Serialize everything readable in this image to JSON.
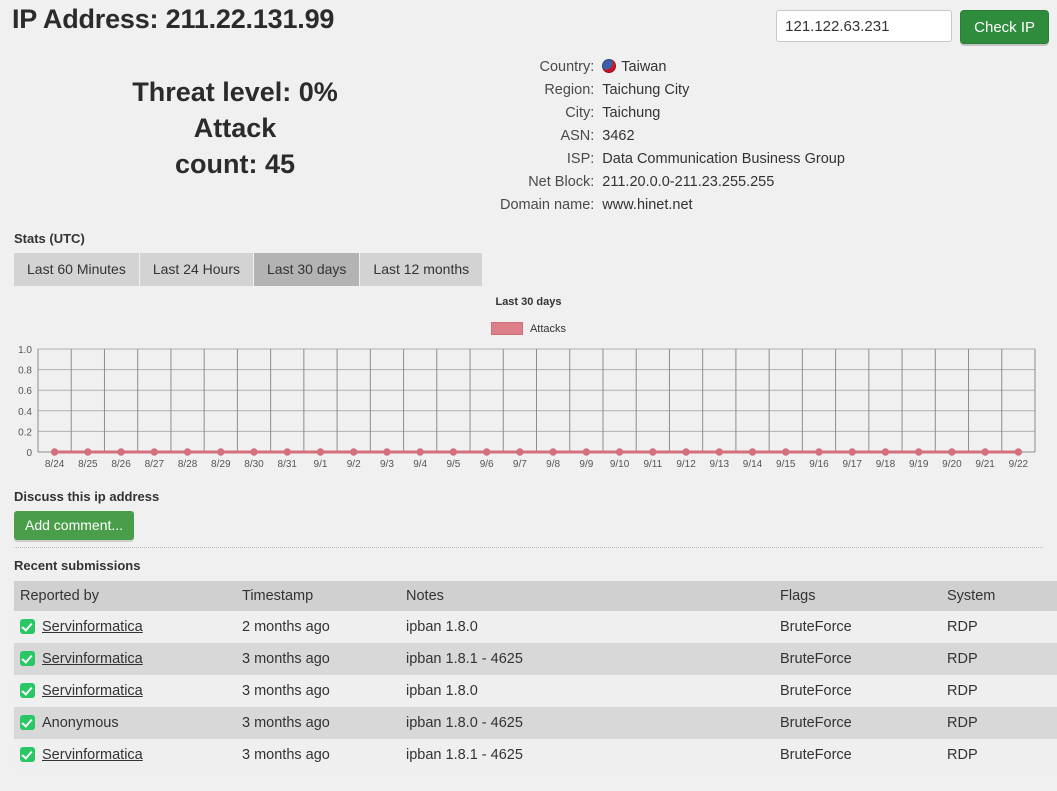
{
  "header": {
    "title": "IP Address: 211.22.131.99",
    "ip_input_value": "121.122.63.231",
    "ip_input_placeholder": "",
    "check_button_label": "Check IP"
  },
  "summary": {
    "threat_level_line": "Threat level: 0%",
    "attack_word": "Attack",
    "attack_count_line": "count: 45"
  },
  "geo": {
    "rows": [
      {
        "label": "Country:",
        "value": "Taiwan",
        "flag": "taiwan-flag-icon"
      },
      {
        "label": "Region:",
        "value": "Taichung City"
      },
      {
        "label": "City:",
        "value": "Taichung"
      },
      {
        "label": "ASN:",
        "value": "3462"
      },
      {
        "label": "ISP:",
        "value": "Data Communication Business Group"
      },
      {
        "label": "Net Block:",
        "value": "211.20.0.0-211.23.255.255"
      },
      {
        "label": "Domain name:",
        "value": "www.hinet.net"
      }
    ]
  },
  "stats": {
    "label": "Stats (UTC)",
    "tabs": [
      {
        "label": "Last 60 Minutes",
        "active": false
      },
      {
        "label": "Last 24 Hours",
        "active": false
      },
      {
        "label": "Last 30 days",
        "active": true
      },
      {
        "label": "Last 12 months",
        "active": false
      }
    ]
  },
  "chart_data": {
    "type": "line",
    "title": "Last 30 days",
    "xlabel": "",
    "ylabel": "",
    "ylim": [
      0,
      1.0
    ],
    "yticks": [
      "0",
      "0.2",
      "0.4",
      "0.6",
      "0.8",
      "1.0"
    ],
    "ytick_values": [
      0,
      0.2,
      0.4,
      0.6,
      0.8,
      1.0
    ],
    "grid": true,
    "legend_position": "top-center",
    "series": [
      {
        "name": "Attacks",
        "color": "#d4707d",
        "marker": "circle",
        "values": [
          0,
          0,
          0,
          0,
          0,
          0,
          0,
          0,
          0,
          0,
          0,
          0,
          0,
          0,
          0,
          0,
          0,
          0,
          0,
          0,
          0,
          0,
          0,
          0,
          0,
          0,
          0,
          0,
          0,
          0
        ]
      }
    ],
    "categories": [
      "8/24",
      "8/25",
      "8/26",
      "8/27",
      "8/28",
      "8/29",
      "8/30",
      "8/31",
      "9/1",
      "9/2",
      "9/3",
      "9/4",
      "9/5",
      "9/6",
      "9/7",
      "9/8",
      "9/9",
      "9/10",
      "9/11",
      "9/12",
      "9/13",
      "9/14",
      "9/15",
      "9/16",
      "9/17",
      "9/18",
      "9/19",
      "9/20",
      "9/21",
      "9/22"
    ]
  },
  "discuss": {
    "label": "Discuss this ip address",
    "add_comment_label": "Add comment..."
  },
  "submissions": {
    "label": "Recent submissions",
    "columns": [
      "Reported by",
      "Timestamp",
      "Notes",
      "Flags",
      "System"
    ],
    "rows": [
      {
        "reporter": "Servinformatica",
        "is_link": true,
        "timestamp": "2 months ago",
        "notes": "ipban 1.8.0",
        "flags": "BruteForce",
        "system": "RDP"
      },
      {
        "reporter": "Servinformatica",
        "is_link": true,
        "timestamp": "3 months ago",
        "notes": "ipban 1.8.1 - 4625",
        "flags": "BruteForce",
        "system": "RDP"
      },
      {
        "reporter": "Servinformatica",
        "is_link": true,
        "timestamp": "3 months ago",
        "notes": "ipban 1.8.0",
        "flags": "BruteForce",
        "system": "RDP"
      },
      {
        "reporter": "Anonymous",
        "is_link": false,
        "timestamp": "3 months ago",
        "notes": "ipban 1.8.0 - 4625",
        "flags": "BruteForce",
        "system": "RDP"
      },
      {
        "reporter": "Servinformatica",
        "is_link": true,
        "timestamp": "3 months ago",
        "notes": "ipban 1.8.1 - 4625",
        "flags": "BruteForce",
        "system": "RDP"
      }
    ]
  }
}
